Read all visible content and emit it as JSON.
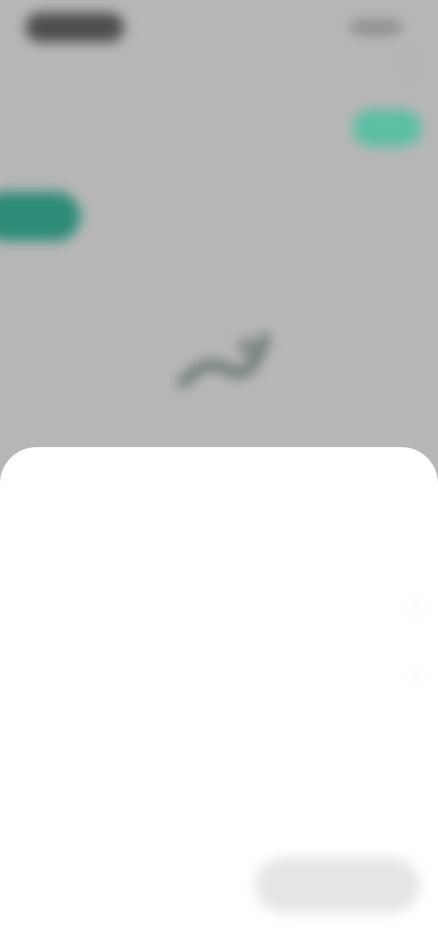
{
  "status_bar": {
    "time": "",
    "battery": ""
  },
  "topbar": {
    "title": "",
    "menu_icon": "more-vert-icon"
  },
  "balance": {
    "label": "",
    "action_label": ""
  },
  "filters": {
    "chips": [
      "",
      "",
      ""
    ]
  },
  "empty_state": {
    "message": "",
    "icon": "chart-illustration-icon"
  },
  "sheet": {
    "title": "",
    "rows": [
      {
        "label": "",
        "chevron": "chevron-right-icon"
      },
      {
        "label": "",
        "chevron": "chevron-right-icon"
      }
    ],
    "reset_label": "",
    "apply_label": ""
  },
  "colors": {
    "accent": "#2c8b76",
    "accent_light": "#5fd1b6",
    "overlay": "#b7b7b7",
    "sheet": "#ffffff",
    "disabled_button": "#e5e5e5"
  }
}
